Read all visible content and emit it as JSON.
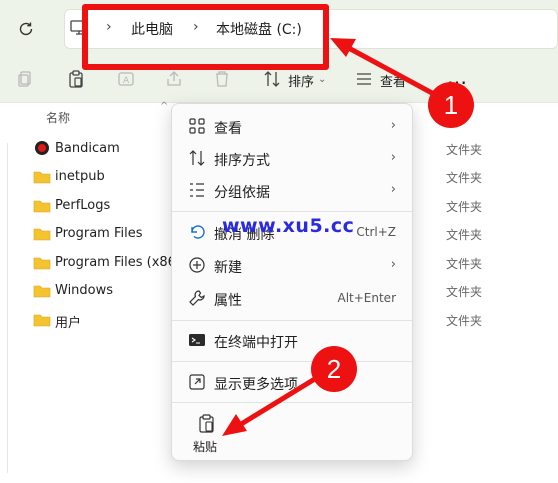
{
  "address_bar": {
    "breadcrumbs": [
      "此电脑",
      "本地磁盘 (C:)"
    ]
  },
  "command_bar": {
    "sort_label": "排序",
    "view_label": "查看",
    "more_label": "…"
  },
  "file_list": {
    "column_name": "名称",
    "rows": [
      {
        "name": "Bandicam",
        "type": "文件夹",
        "icon": "recording-icon"
      },
      {
        "name": "inetpub",
        "type": "文件夹",
        "icon": "folder-icon"
      },
      {
        "name": "PerfLogs",
        "type": "文件夹",
        "icon": "folder-icon"
      },
      {
        "name": "Program Files",
        "type": "文件夹",
        "icon": "folder-icon"
      },
      {
        "name": "Program Files (x86)",
        "type": "文件夹",
        "icon": "folder-icon"
      },
      {
        "name": "Windows",
        "type": "文件夹",
        "icon": "folder-icon"
      },
      {
        "name": "用户",
        "type": "文件夹",
        "icon": "folder-icon"
      }
    ]
  },
  "context_menu": {
    "view": "查看",
    "sort_by": "排序方式",
    "group_by": "分组依据",
    "undo": "撤消 删除",
    "undo_shortcut": "Ctrl+Z",
    "new": "新建",
    "properties": "属性",
    "properties_shortcut": "Alt+Enter",
    "open_terminal": "在终端中打开",
    "show_more": "显示更多选项",
    "paste": "粘贴"
  },
  "watermark": "www.xu5.cc",
  "annotations": {
    "badge1": "1",
    "badge2": "2",
    "color": "#ee1111"
  }
}
